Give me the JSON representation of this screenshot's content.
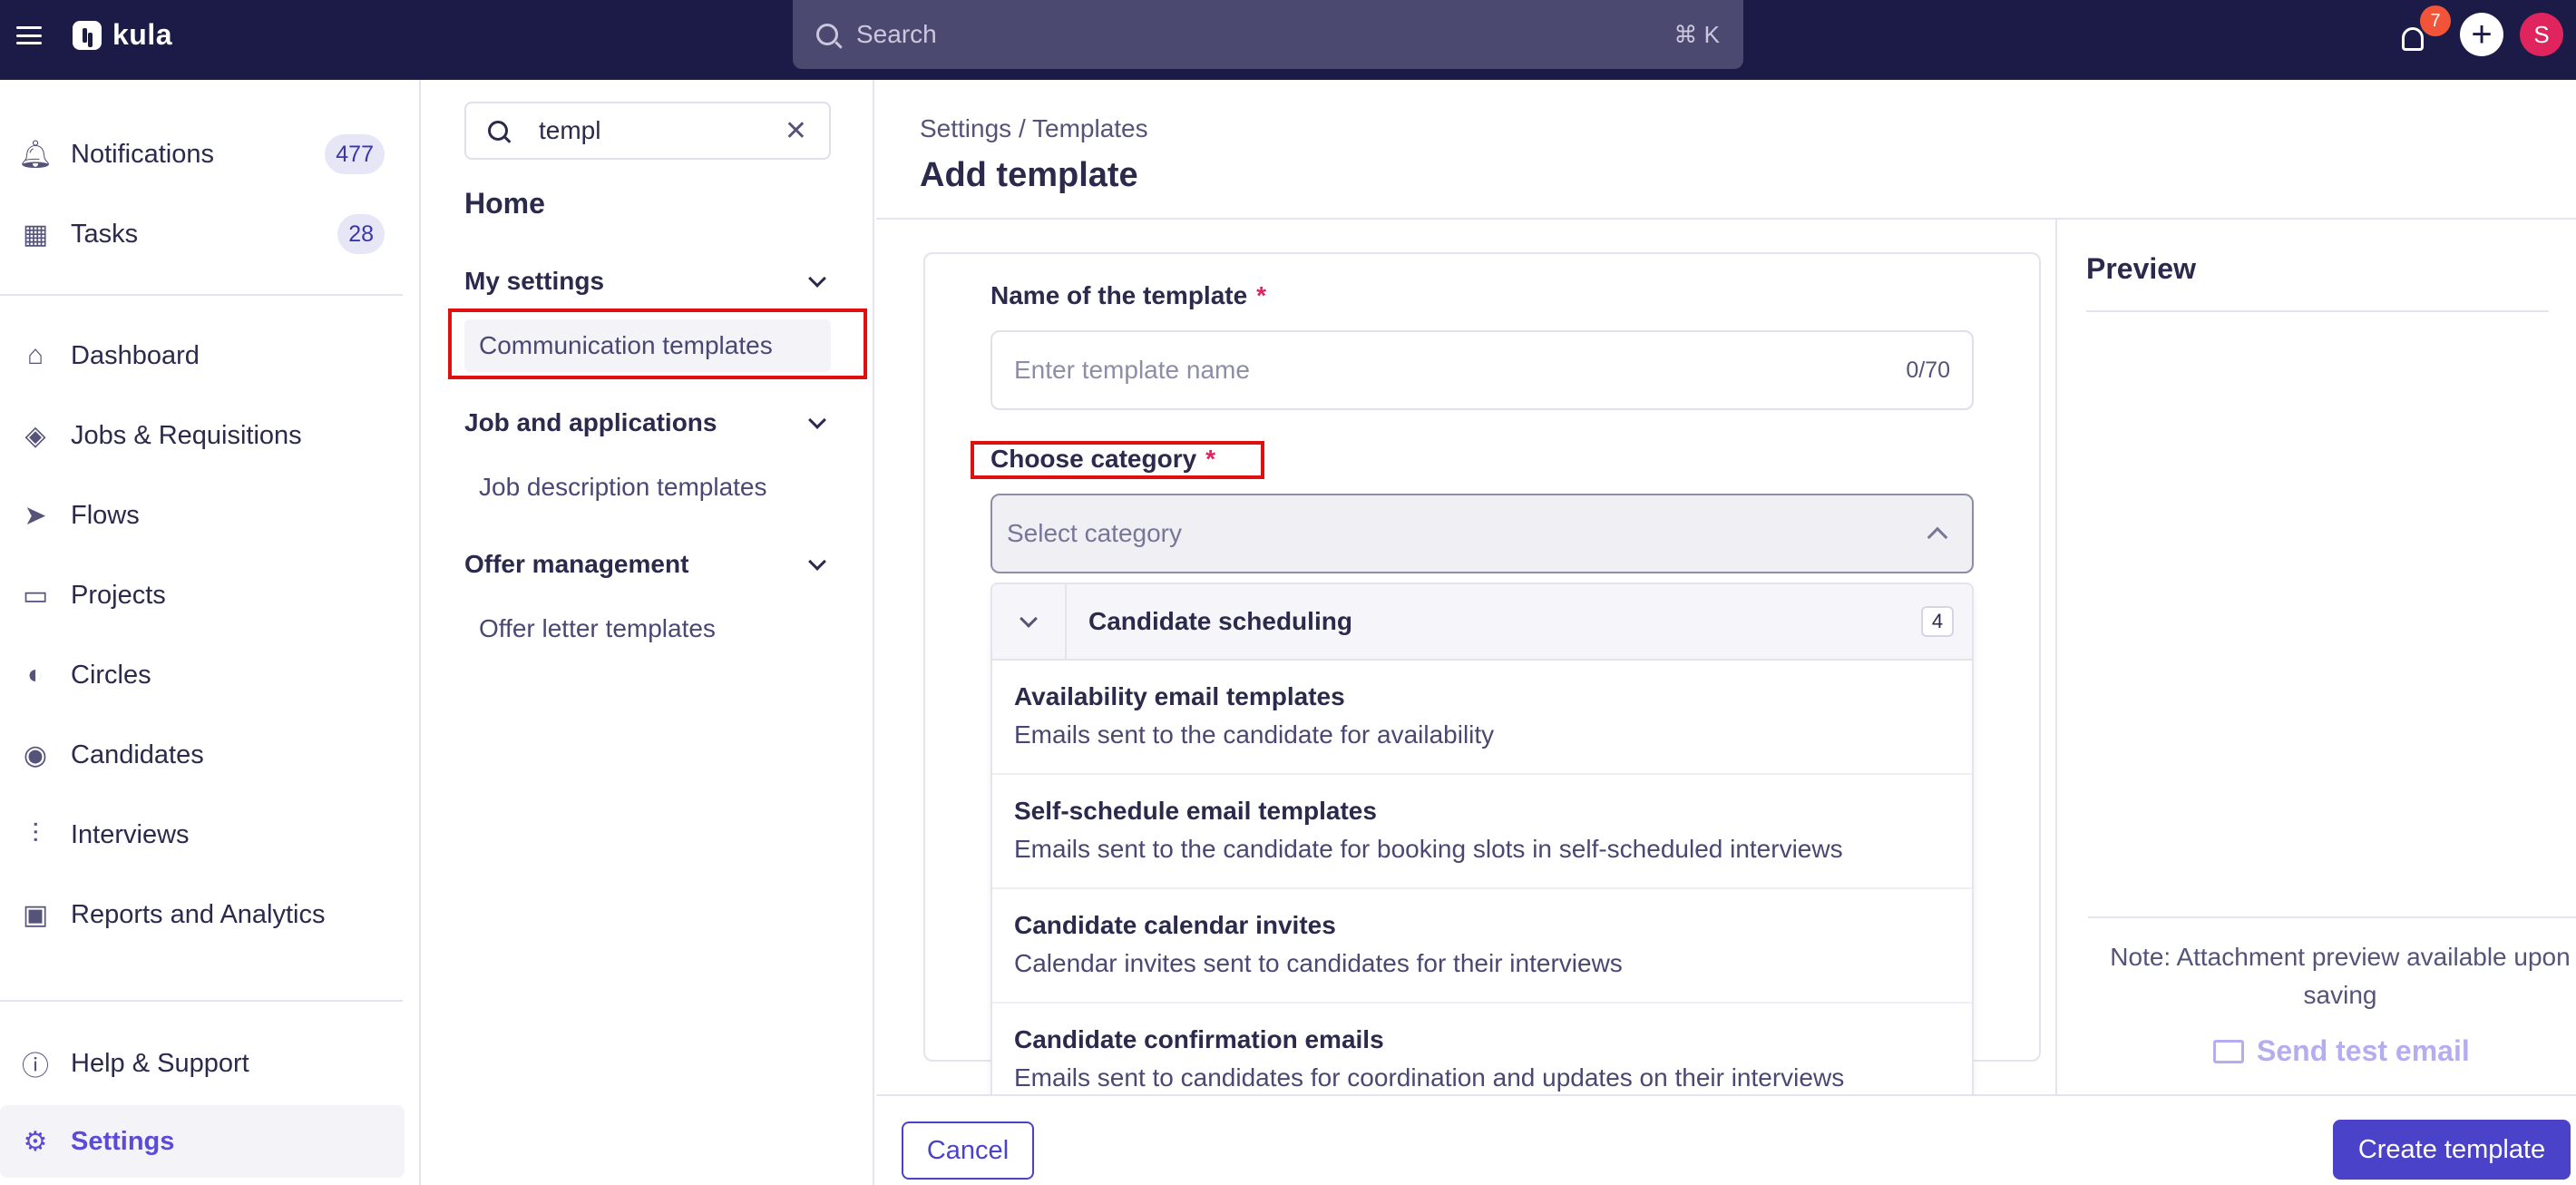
{
  "topbar": {
    "app_name": "kula",
    "search_placeholder": "Search",
    "search_shortcut": "⌘ K",
    "notification_badge": "7",
    "avatar_initial": "S"
  },
  "leftnav": {
    "items": [
      {
        "label": "Notifications",
        "count": "477",
        "icon": "bell-icon"
      },
      {
        "label": "Tasks",
        "count": "28",
        "icon": "calendar-icon"
      },
      {
        "label": "Dashboard",
        "icon": "home-icon"
      },
      {
        "label": "Jobs & Requisitions",
        "icon": "layers-icon"
      },
      {
        "label": "Flows",
        "icon": "send-icon"
      },
      {
        "label": "Projects",
        "icon": "folder-icon"
      },
      {
        "label": "Circles",
        "icon": "circles-icon"
      },
      {
        "label": "Candidates",
        "icon": "user-circle-icon"
      },
      {
        "label": "Interviews",
        "icon": "waveform-icon"
      },
      {
        "label": "Reports and Analytics",
        "icon": "chart-icon"
      },
      {
        "label": "Help & Support",
        "icon": "help-icon"
      },
      {
        "label": "Settings",
        "icon": "gear-icon"
      }
    ]
  },
  "settings": {
    "search_value": "templ",
    "home": "Home",
    "groups": [
      {
        "label": "My settings",
        "items": [
          "Communication templates"
        ]
      },
      {
        "label": "Job and applications",
        "items": [
          "Job description templates"
        ]
      },
      {
        "label": "Offer management",
        "items": [
          "Offer letter templates"
        ]
      }
    ]
  },
  "main": {
    "breadcrumb": "Settings / Templates",
    "title": "Add template",
    "name_label": "Name of the template",
    "required_mark": "*",
    "name_placeholder": "Enter template name",
    "name_counter": "0/70",
    "category_label": "Choose category",
    "category_placeholder": "Select category",
    "dropdown": {
      "group": "Candidate scheduling",
      "group_count": "4",
      "options": [
        {
          "title": "Availability email templates",
          "desc": "Emails sent to the candidate for availability"
        },
        {
          "title": "Self-schedule email templates",
          "desc": "Emails sent to the candidate for booking slots in self-scheduled interviews"
        },
        {
          "title": "Candidate calendar invites",
          "desc": "Calendar invites sent to candidates for their interviews"
        },
        {
          "title": "Candidate confirmation emails",
          "desc": "Emails sent to candidates for coordination and updates on their interviews"
        }
      ]
    }
  },
  "preview": {
    "title": "Preview",
    "note": "Note: Attachment preview available upon saving",
    "send_test": "Send test email"
  },
  "footer": {
    "cancel": "Cancel",
    "create": "Create template"
  },
  "colors": {
    "topbar_bg": "#1c1a46",
    "accent": "#4a42c8",
    "active_nav": "#5b4bd6",
    "highlight_box": "#e01010",
    "required": "#e0245e"
  }
}
